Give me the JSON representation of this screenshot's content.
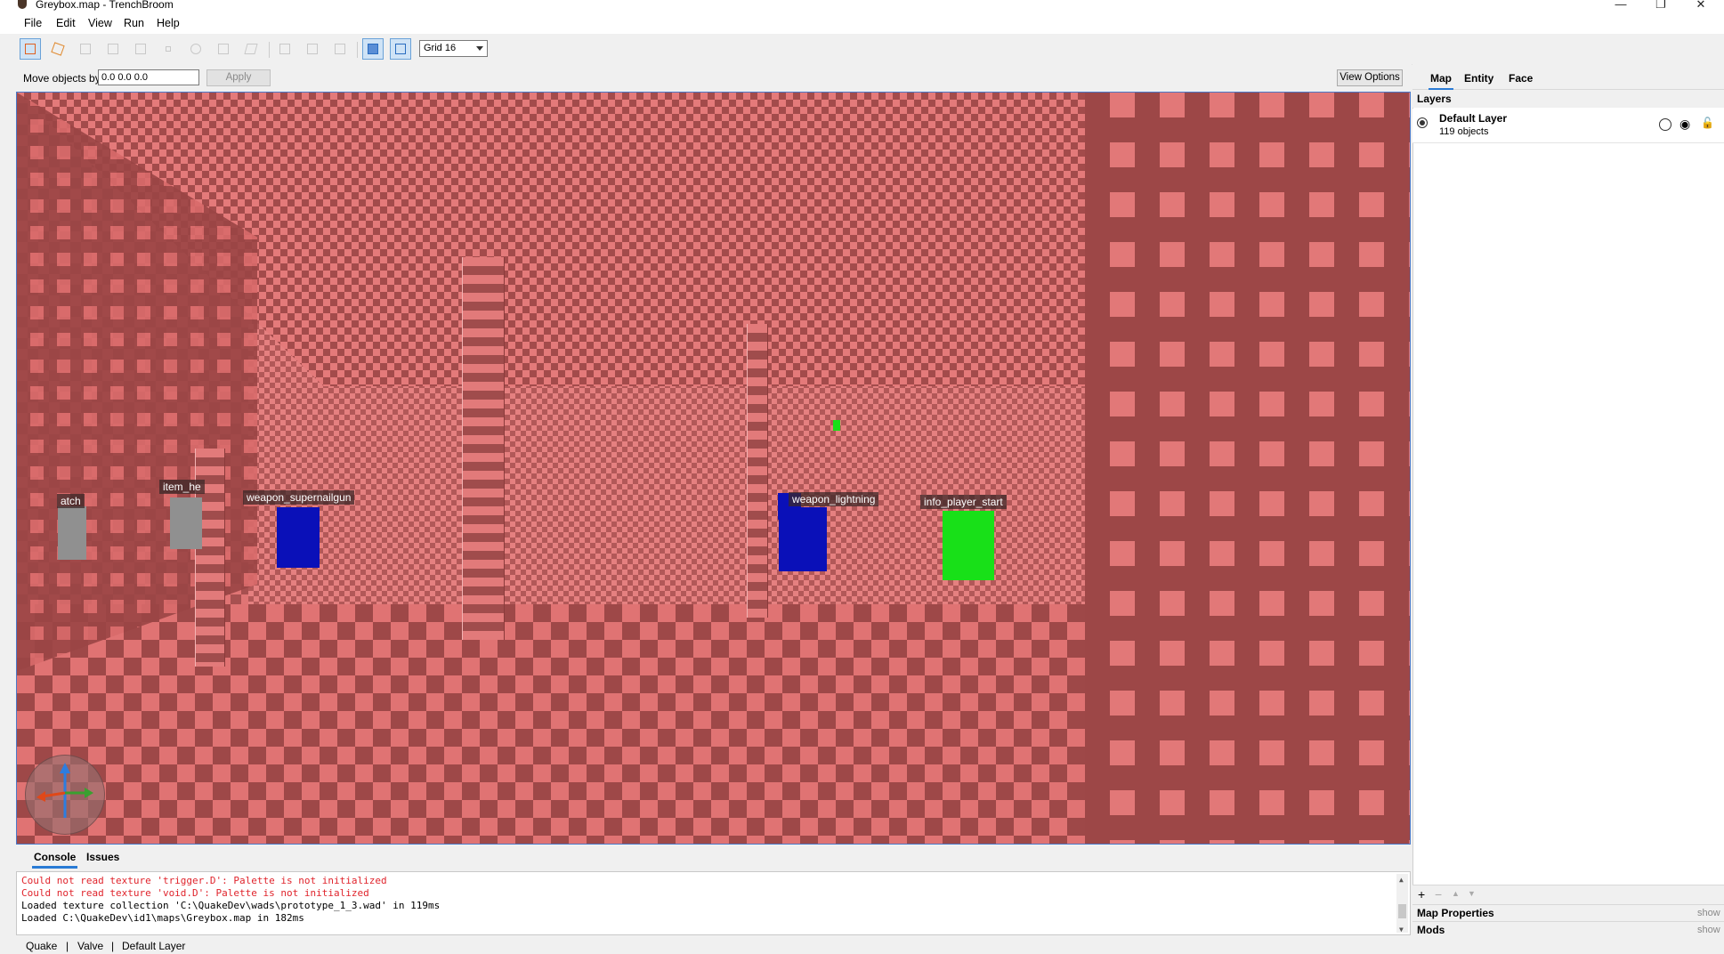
{
  "window": {
    "title": "Greybox.map - TrenchBroom",
    "minimize_icon": "minimize-icon",
    "maximize_icon": "restore-icon",
    "close_icon": "close-icon"
  },
  "menu": [
    "File",
    "Edit",
    "View",
    "Run",
    "Help"
  ],
  "toolbar": {
    "grid_value": "Grid 16"
  },
  "movebar": {
    "label": "Move objects by",
    "value": "0.0 0.0 0.0",
    "apply_label": "Apply",
    "view_options_label": "View Options"
  },
  "viewport": {
    "entities": [
      {
        "label": "weapon_supernailgun",
        "color": "#0a10b8"
      },
      {
        "label": "weapon_lightning",
        "color": "#0a10b8"
      },
      {
        "label": "info_player_start",
        "color": "#18e018"
      },
      {
        "label": "item_he",
        "color": "#909090"
      },
      {
        "label": "atch",
        "color": "#909090"
      }
    ]
  },
  "console": {
    "tabs": [
      "Console",
      "Issues"
    ],
    "lines": [
      {
        "text": "Could not read texture 'trigger.D': Palette is not initialized",
        "level": "error"
      },
      {
        "text": "Could not read texture 'void.D': Palette is not initialized",
        "level": "error"
      },
      {
        "text": "Loaded texture collection 'C:\\QuakeDev\\wads\\prototype_1_3.wad' in 119ms",
        "level": "info"
      },
      {
        "text": "Loaded C:\\QuakeDev\\id1\\maps\\Greybox.map in 182ms",
        "level": "info"
      }
    ]
  },
  "statusbar": {
    "game": "Quake",
    "sep": "|",
    "format": "Valve",
    "layer": "Default Layer"
  },
  "rightpanel": {
    "tabs": [
      "Map",
      "Entity",
      "Face"
    ],
    "layers_title": "Layers",
    "layer": {
      "name": "Default Layer",
      "count": "119 objects"
    },
    "footer_buttons": [
      "+",
      "−",
      "▲",
      "▼"
    ],
    "map_properties": {
      "label": "Map Properties",
      "action": "show"
    },
    "mods": {
      "label": "Mods",
      "action": "show"
    }
  }
}
